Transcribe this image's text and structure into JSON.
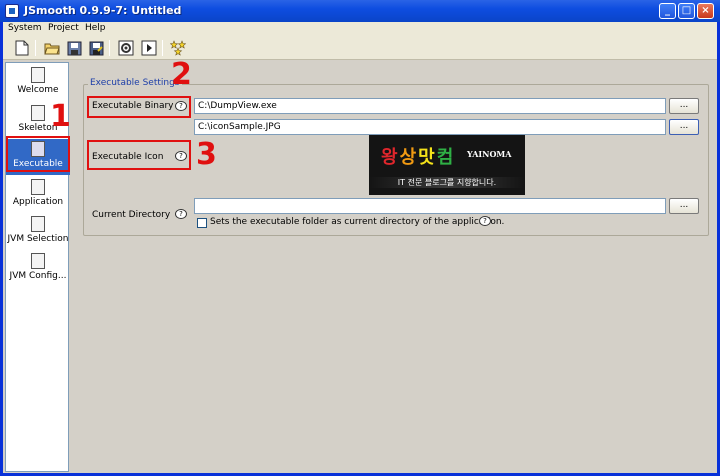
{
  "window": {
    "title": "JSmooth 0.9.9-7: Untitled",
    "buttons": [
      "_",
      "□",
      "×"
    ]
  },
  "menu": [
    "System",
    "Project",
    "Help"
  ],
  "toolbar": [
    "new-icon",
    "open-icon",
    "save-icon",
    "save-as-icon",
    "compile-icon",
    "run-icon",
    "wizard-icon"
  ],
  "sidebar": [
    {
      "label": "Welcome",
      "icon": "welcome-icon"
    },
    {
      "label": "Skeleton",
      "icon": "skeleton-icon"
    },
    {
      "label": "Executable",
      "icon": "executable-icon",
      "selected": true
    },
    {
      "label": "Application",
      "icon": "application-icon"
    },
    {
      "label": "JVM Selection",
      "icon": "jvm-selection-icon"
    },
    {
      "label": "JVM Config...",
      "icon": "jvm-config-icon"
    }
  ],
  "settings": {
    "group_title": "Executable Settings",
    "binary_label": "Executable Binary",
    "binary_value": "C:\\DumpView.exe",
    "icon_label": "Executable Icon",
    "icon_value": "C:\\iconSample.JPG",
    "directory_label": "Current Directory",
    "directory_value": "",
    "checkbox_label": "Sets the executable folder as current directory of the application.",
    "checkbox_checked": false,
    "browse_label": "...",
    "help_symbol": "?"
  },
  "icon_preview": {
    "text_kr": [
      "왕",
      "상",
      "맛",
      "컴"
    ],
    "text_en": "YAINOMA",
    "tagline": "IT 전문 블로그를 지향합니다."
  },
  "annotations": [
    "1",
    "2",
    "3"
  ],
  "colors": {
    "highlight": "#e01010",
    "selected": "#3169c6",
    "titlebar": "#0e4de0"
  }
}
